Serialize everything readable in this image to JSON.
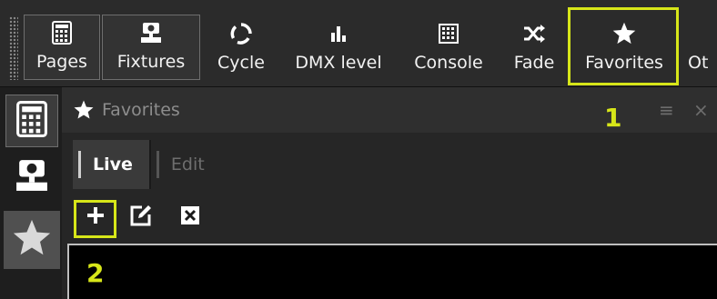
{
  "toolbar": {
    "items": [
      {
        "label": "Pages",
        "icon": "pages-grid-icon"
      },
      {
        "label": "Fixtures",
        "icon": "fixture-icon"
      },
      {
        "label": "Cycle",
        "icon": "cycle-icon"
      },
      {
        "label": "DMX level",
        "icon": "dmx-level-icon"
      },
      {
        "label": "Console",
        "icon": "console-icon"
      },
      {
        "label": "Fade",
        "icon": "shuffle-icon"
      },
      {
        "label": "Favorites",
        "icon": "star-icon"
      },
      {
        "label": "Ot",
        "icon": ""
      }
    ]
  },
  "sidebar": {
    "tabs": [
      {
        "icon": "pages-grid-icon",
        "selected": true
      },
      {
        "icon": "fixture-icon",
        "selected": false
      },
      {
        "icon": "star-icon",
        "selected": false
      }
    ]
  },
  "panel": {
    "title": "Favorites",
    "menu_icon": "≡",
    "close_icon": "×",
    "tabs": [
      {
        "label": "Live",
        "active": true
      },
      {
        "label": "Edit",
        "active": false
      }
    ],
    "actions": [
      "add-icon",
      "edit-icon",
      "delete-icon"
    ]
  },
  "annotations": {
    "callout_1": "1",
    "callout_2": "2",
    "highlight_color": "#d7e619"
  },
  "colors": {
    "toolbar_bg": "#2b2b2b",
    "panel_bg": "#262626",
    "list_bg": "#000000"
  }
}
